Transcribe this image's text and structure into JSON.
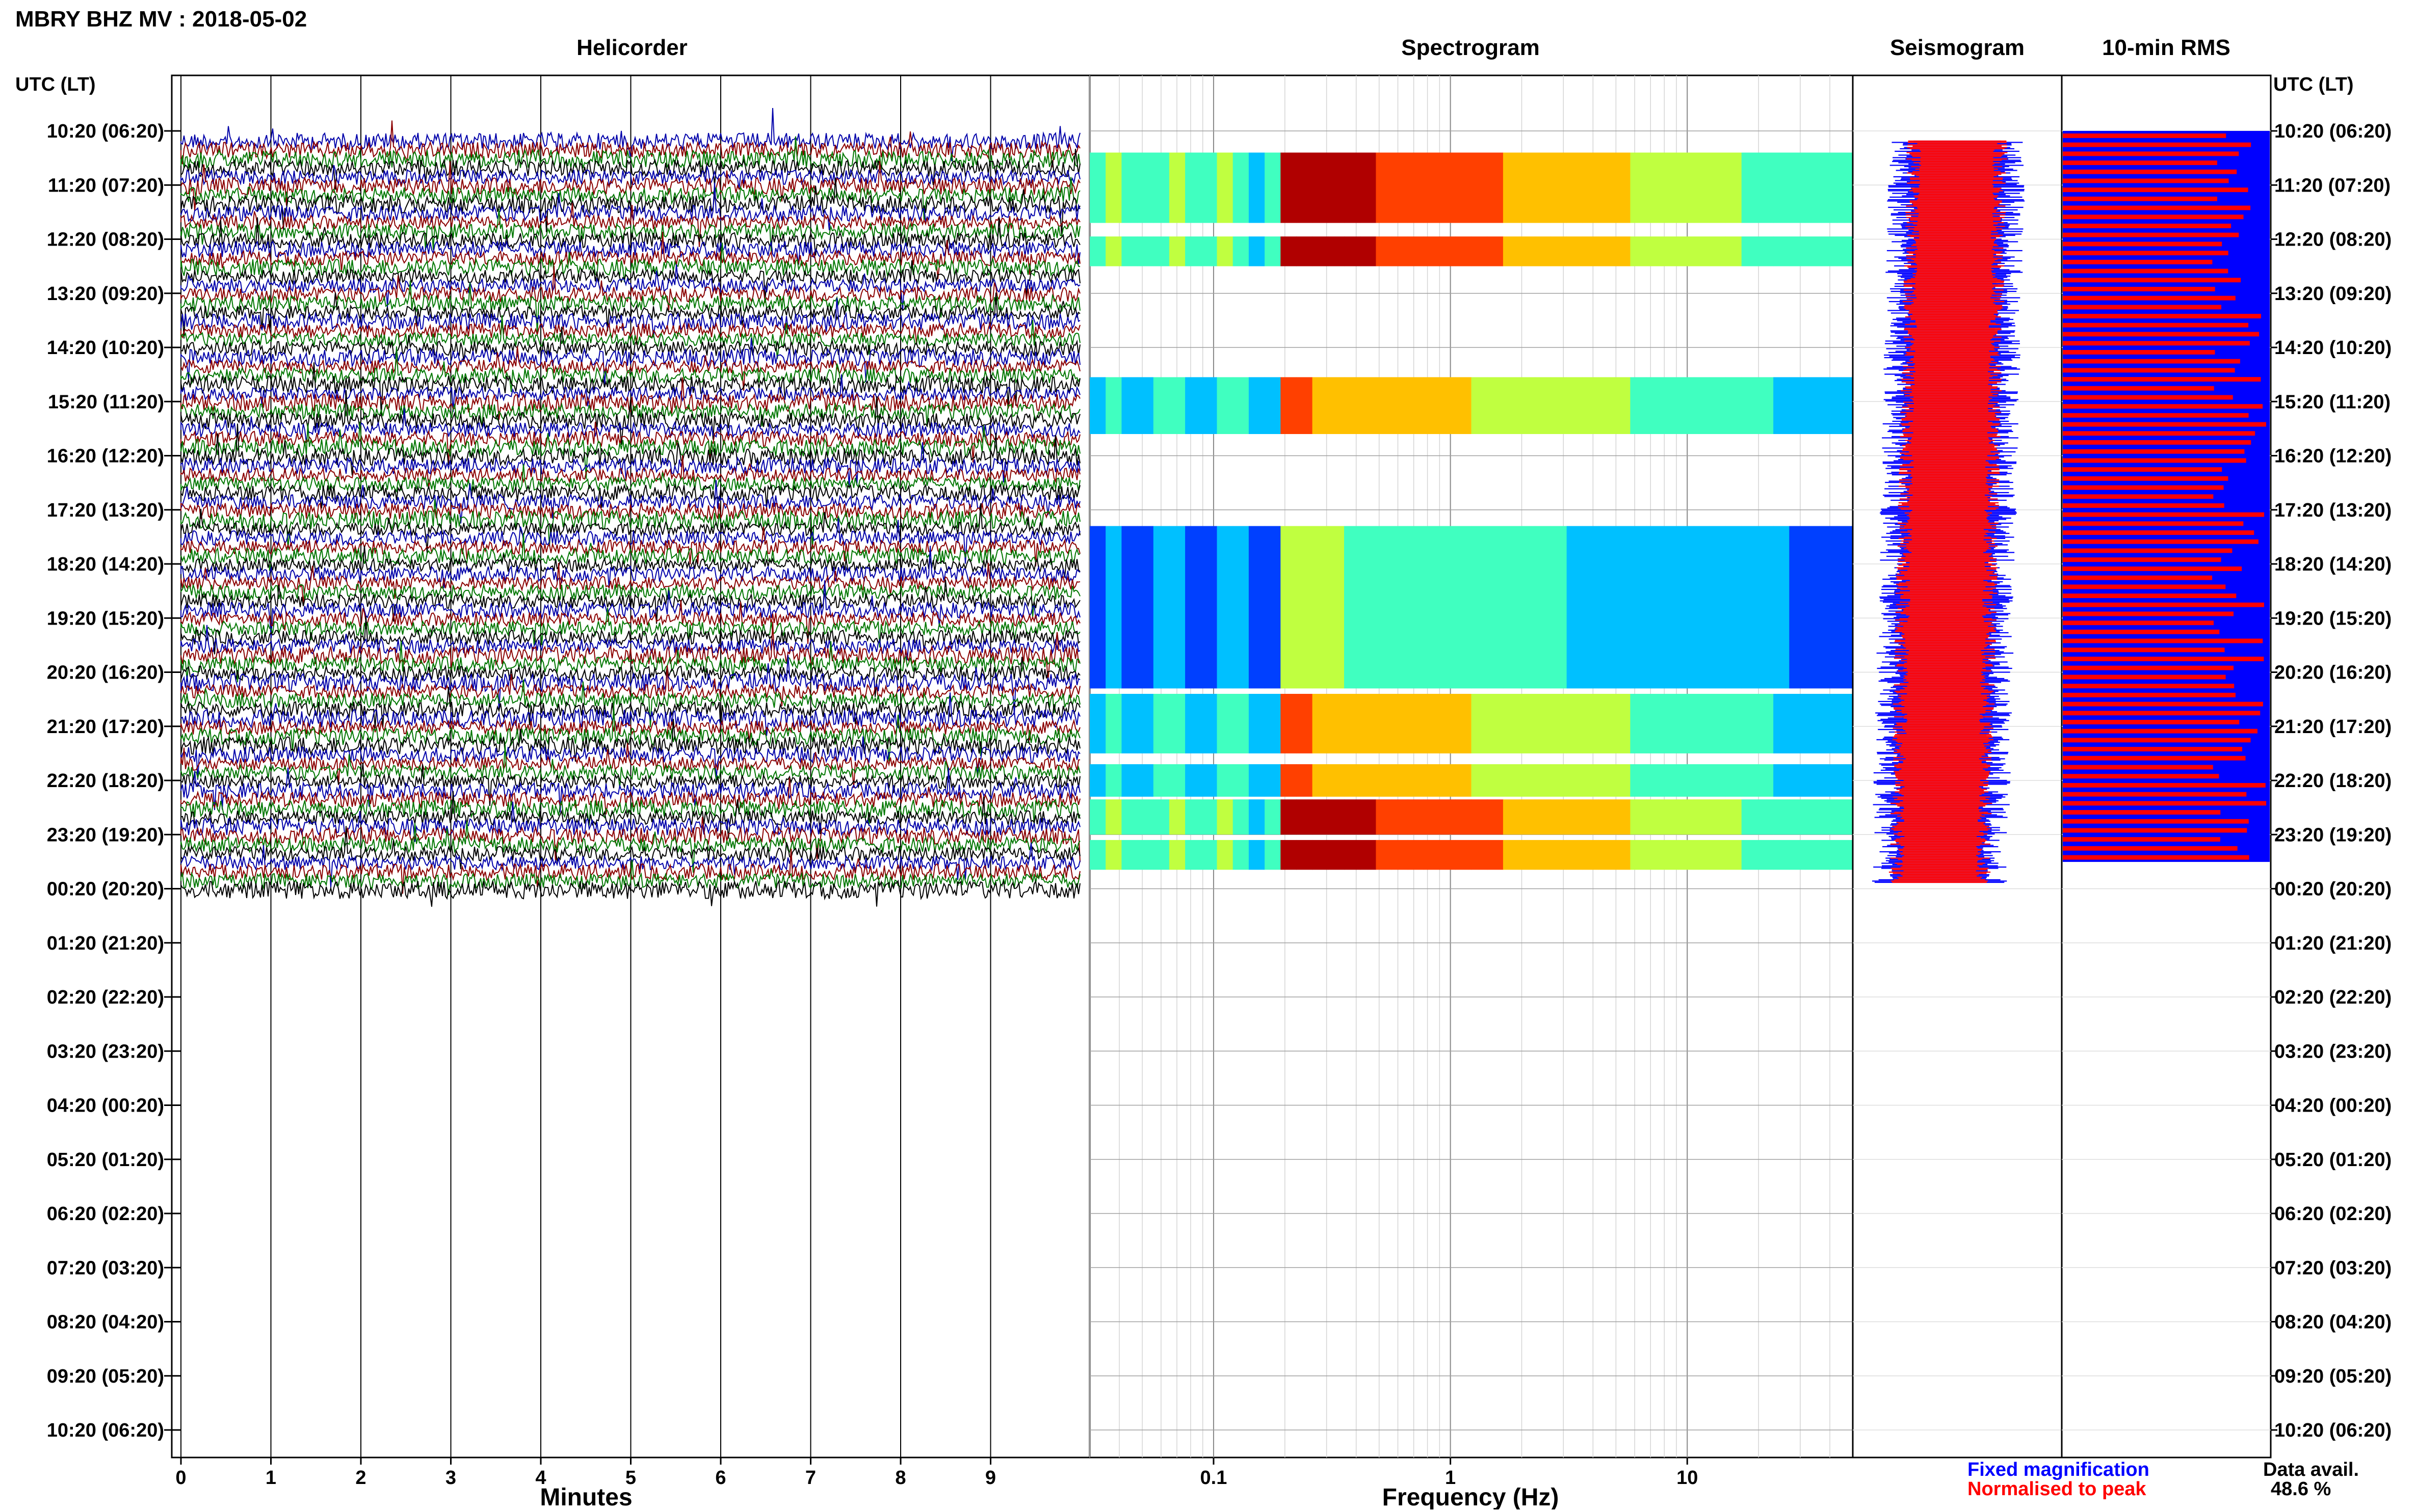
{
  "header": {
    "title": "MBRY BHZ MV : 2018-05-02"
  },
  "panels": {
    "helicorder": "Helicorder",
    "spectrogram": "Spectrogram",
    "seismogram": "Seismogram",
    "rms": "10-min RMS"
  },
  "axes": {
    "time_label_left": "UTC (LT)",
    "time_label_right": "UTC (LT)",
    "time_ticks": [
      "10:20 (06:20)",
      "11:20 (07:20)",
      "12:20 (08:20)",
      "13:20 (09:20)",
      "14:20 (10:20)",
      "15:20 (11:20)",
      "16:20 (12:20)",
      "17:20 (13:20)",
      "18:20 (14:20)",
      "19:20 (15:20)",
      "20:20 (16:20)",
      "21:20 (17:20)",
      "22:20 (18:20)",
      "23:20 (19:20)",
      "00:20 (20:20)",
      "01:20 (21:20)",
      "02:20 (22:20)",
      "03:20 (23:20)",
      "04:20 (00:20)",
      "05:20 (01:20)",
      "06:20 (02:20)",
      "07:20 (03:20)",
      "08:20 (04:20)",
      "09:20 (05:20)",
      "10:20 (06:20)"
    ],
    "minutes_label": "Minutes",
    "minutes_ticks": [
      "0",
      "1",
      "2",
      "3",
      "4",
      "5",
      "6",
      "7",
      "8",
      "9"
    ],
    "frequency_label": "Frequency (Hz)",
    "frequency_ticks": [
      "0.1",
      "1",
      "10"
    ]
  },
  "legend": {
    "fixed": "Fixed magnification",
    "normalised": "Normalised to peak",
    "fixed_color": "#0000ff",
    "normalised_color": "#ff0000"
  },
  "availability": {
    "label": "Data avail.",
    "value": "48.6 %"
  },
  "colors": {
    "helicorder_traces": [
      "#0000aa",
      "#8b0000",
      "#007700",
      "#000000"
    ],
    "spectrogram_colormap": [
      "#00008b",
      "#0040ff",
      "#00c0ff",
      "#40ffc0",
      "#c0ff40",
      "#ffc000",
      "#ff4000",
      "#b00000"
    ]
  },
  "chart_data": [
    {
      "type": "line",
      "title": "Helicorder",
      "xlabel": "Minutes",
      "ylabel": "UTC (LT)",
      "xlim": [
        0,
        10
      ],
      "rows_with_data": 14,
      "row_interval_hours": 1,
      "lines_per_row": 6
    },
    {
      "type": "heatmap",
      "title": "Spectrogram",
      "xlabel": "Frequency (Hz)",
      "x_scale": "log",
      "xlim": [
        0.03,
        50
      ],
      "dominant_frequency_band_hz": [
        0.2,
        0.5
      ],
      "bands": [
        {
          "start_hour": 0.4,
          "end_hour": 1.7,
          "intensity": "high"
        },
        {
          "start_hour": 1.95,
          "end_hour": 2.5,
          "intensity": "high"
        },
        {
          "start_hour": 4.55,
          "end_hour": 5.6,
          "intensity": "medium"
        },
        {
          "start_hour": 7.3,
          "end_hour": 10.3,
          "intensity": "low"
        },
        {
          "start_hour": 10.4,
          "end_hour": 11.5,
          "intensity": "medium"
        },
        {
          "start_hour": 11.7,
          "end_hour": 12.3,
          "intensity": "medium"
        },
        {
          "start_hour": 12.35,
          "end_hour": 13.0,
          "intensity": "high"
        },
        {
          "start_hour": 13.1,
          "end_hour": 13.65,
          "intensity": "high"
        }
      ]
    },
    {
      "type": "line",
      "title": "Seismogram",
      "series": [
        {
          "name": "Fixed magnification",
          "color": "#0000ff"
        },
        {
          "name": "Normalised to peak",
          "color": "#ff0000"
        }
      ],
      "hours_with_data": 13.9
    },
    {
      "type": "bar",
      "title": "10-min RMS",
      "series": [
        {
          "name": "Fixed magnification",
          "color": "#0000ff"
        },
        {
          "name": "Normalised to peak",
          "color": "#ff0000"
        }
      ],
      "bar_interval_minutes": 10,
      "bars": 81,
      "normalised_relative_range": [
        0.72,
        1.0
      ]
    }
  ]
}
